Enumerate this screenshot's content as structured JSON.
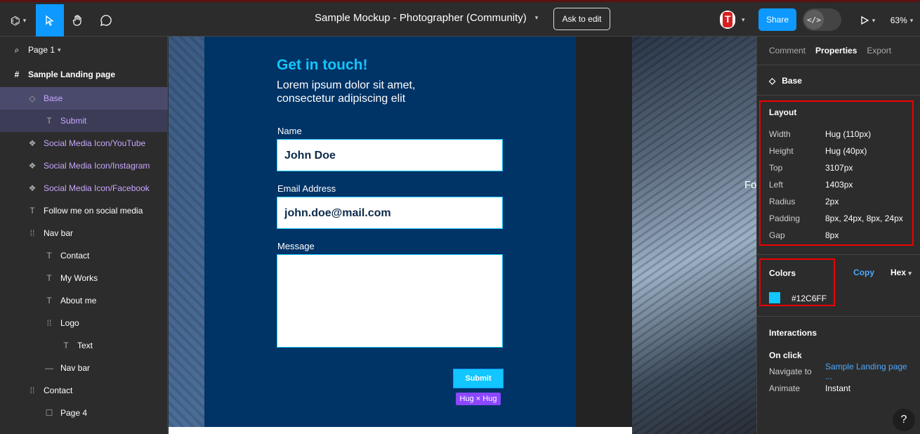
{
  "topbar": {
    "file_title": "Sample Mockup - Photographer (Community)",
    "ask_edit": "Ask to edit",
    "share": "Share",
    "zoom": "63%",
    "dev_mode_glyph": "</>",
    "avatar_letter": "T"
  },
  "layers": {
    "page": "Page 1",
    "frame": "Sample Landing page",
    "items": [
      {
        "label": "Base"
      },
      {
        "label": "Submit"
      },
      {
        "label": "Social Media Icon/YouTube"
      },
      {
        "label": "Social Media Icon/Instagram"
      },
      {
        "label": "Social Media Icon/Facebook"
      },
      {
        "label": "Follow me on social media"
      },
      {
        "label": "Nav bar"
      },
      {
        "label": "Contact"
      },
      {
        "label": "My Works"
      },
      {
        "label": "About me"
      },
      {
        "label": "Logo"
      },
      {
        "label": "Text"
      },
      {
        "label": "Nav bar"
      },
      {
        "label": "Contact"
      },
      {
        "label": "Page 4"
      }
    ]
  },
  "canvas": {
    "heading": "Get in touch!",
    "subheading": "Lorem ipsum dolor sit amet, consectetur adipiscing elit",
    "name_label": "Name",
    "name_value": "John Doe",
    "email_label": "Email Address",
    "email_value": "john.doe@mail.com",
    "message_label": "Message",
    "submit": "Submit",
    "hug_tag": "Hug × Hug",
    "partial_text": "Fo"
  },
  "inspector": {
    "tabs": {
      "comment": "Comment",
      "properties": "Properties",
      "export": "Export"
    },
    "selected": "Base",
    "layout_title": "Layout",
    "layout": [
      {
        "k": "Width",
        "v": "Hug (110px)"
      },
      {
        "k": "Height",
        "v": "Hug (40px)"
      },
      {
        "k": "Top",
        "v": "3107px"
      },
      {
        "k": "Left",
        "v": "1403px"
      },
      {
        "k": "Radius",
        "v": "2px"
      },
      {
        "k": "Padding",
        "v": "8px, 24px, 8px, 24px"
      },
      {
        "k": "Gap",
        "v": "8px"
      }
    ],
    "colors_title": "Colors",
    "copy": "Copy",
    "format": "Hex",
    "color_value": "#12C6FF",
    "interactions_title": "Interactions",
    "on_click": "On click",
    "navigate_k": "Navigate to",
    "navigate_v": "Sample Landing page ...",
    "animate_k": "Animate",
    "animate_v": "Instant",
    "help": "?"
  },
  "colors": {
    "accent": "#12C6FF",
    "card_bg": "#003366",
    "share_blue": "#0d99ff",
    "highlight_red": "#ee0000"
  }
}
